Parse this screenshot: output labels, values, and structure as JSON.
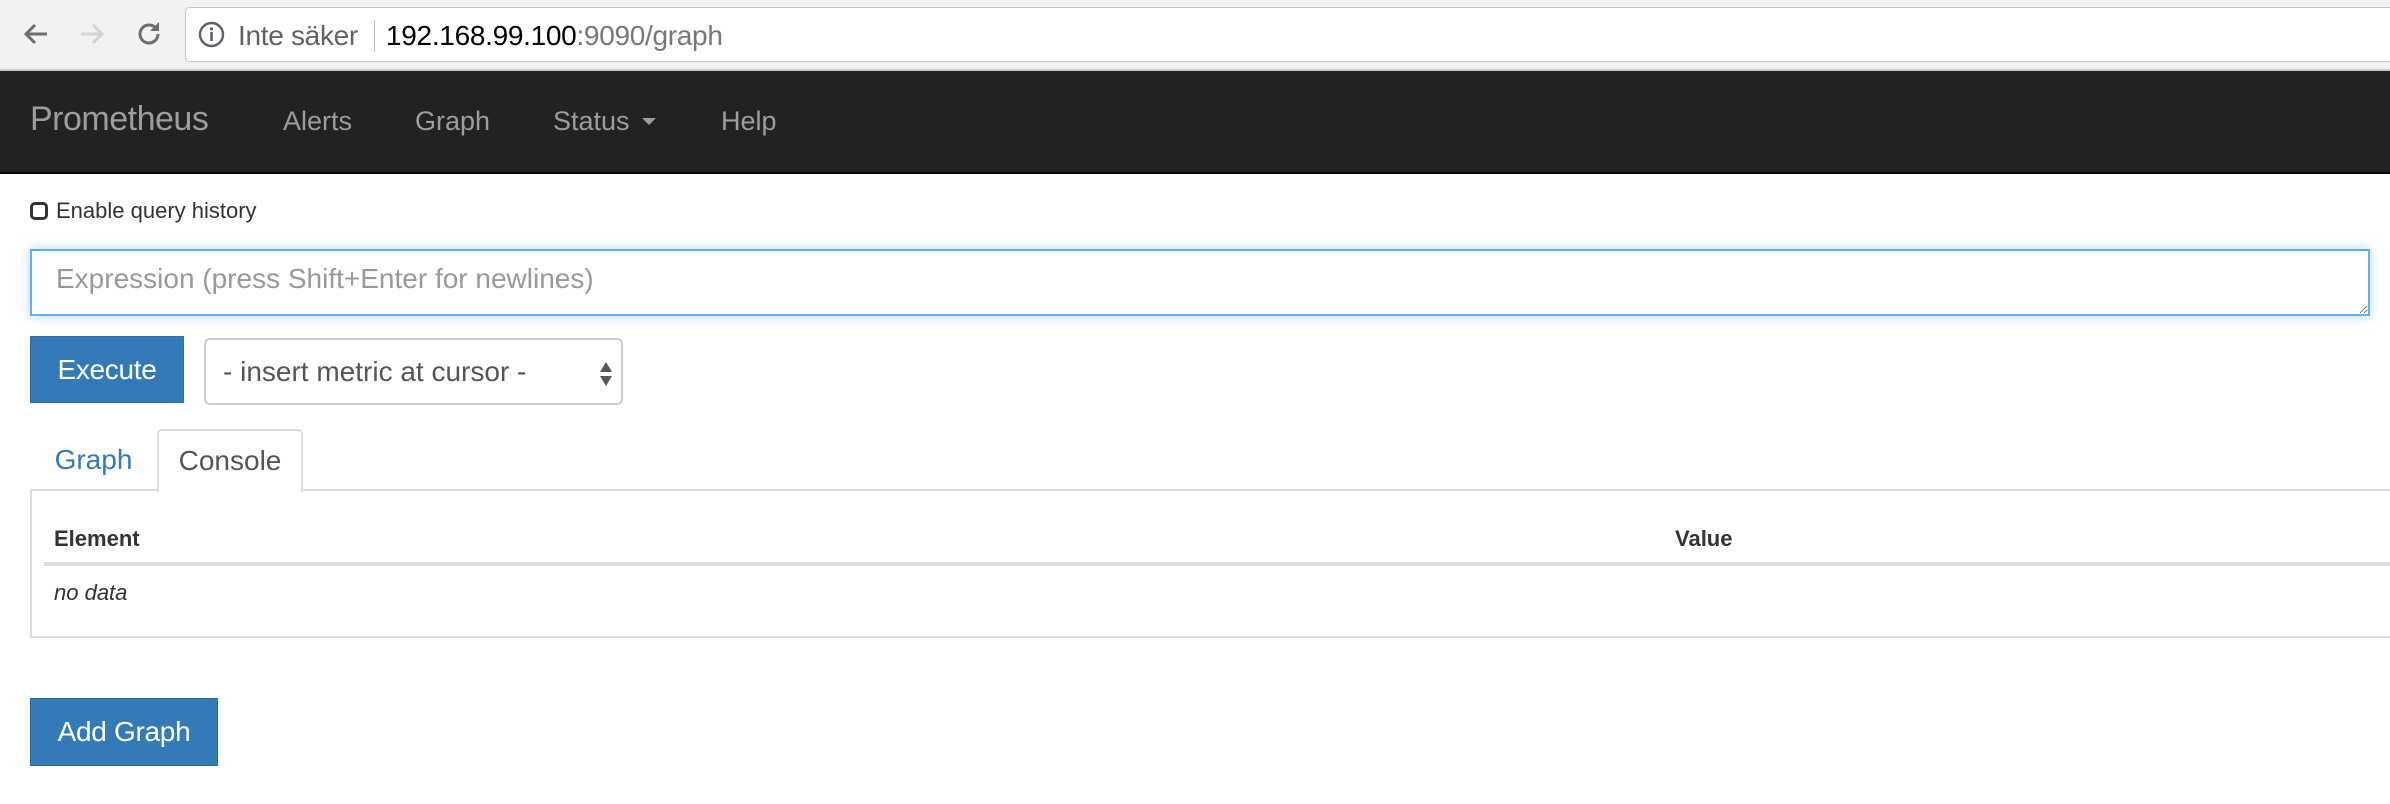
{
  "browser": {
    "security_label": "Inte säker",
    "url_host": "192.168.99.100",
    "url_rest": ":9090/graph",
    "icons": [
      "back-arrow-icon",
      "forward-arrow-icon",
      "reload-icon",
      "info-icon"
    ]
  },
  "navbar": {
    "brand": "Prometheus",
    "items": [
      {
        "label": "Alerts"
      },
      {
        "label": "Graph"
      },
      {
        "label": "Status",
        "has_dropdown": true
      },
      {
        "label": "Help"
      }
    ]
  },
  "query": {
    "history_label": "Enable query history",
    "history_checked": false,
    "expression_value": "",
    "expression_placeholder": "Expression (press Shift+Enter for newlines)",
    "execute_label": "Execute",
    "metric_select_value": "- insert metric at cursor -"
  },
  "tabs": [
    {
      "label": "Graph",
      "active": false
    },
    {
      "label": "Console",
      "active": true
    }
  ],
  "console": {
    "columns": [
      "Element",
      "Value"
    ],
    "empty_text": "no data"
  },
  "add_graph_label": "Add Graph",
  "colors": {
    "primary": "#337ab7",
    "navbar_bg": "#222222",
    "navbar_text": "#9d9d9d",
    "focus_border": "#66afe9"
  }
}
